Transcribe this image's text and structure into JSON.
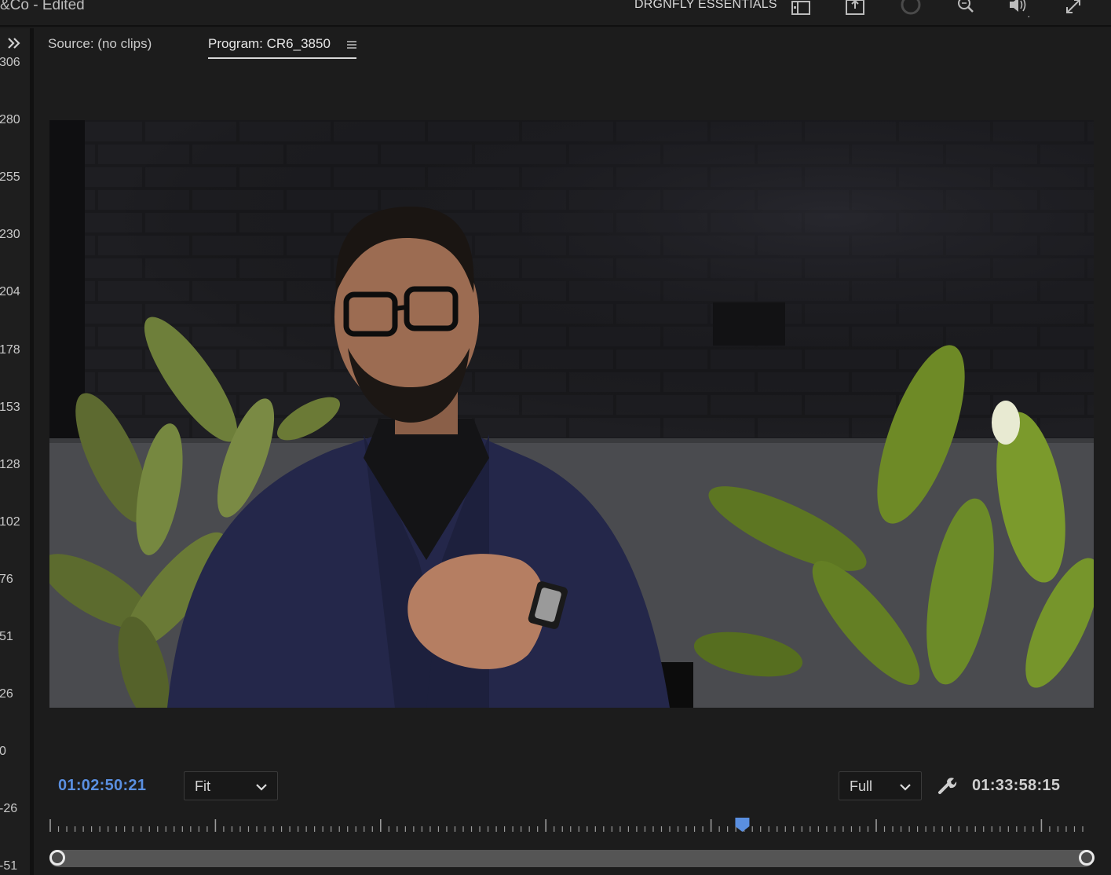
{
  "app": {
    "title": "&Co - Edited",
    "workspace": "DRGNFLY ESSENTIALS"
  },
  "toolbar_icons": [
    "panel-layout-icon",
    "export-icon",
    "progress-ring-icon",
    "search-icon",
    "volume-icon",
    "fullscreen-icon"
  ],
  "meter": {
    "expand_icon": "double-chevron-right-icon",
    "labels": [
      "306",
      "280",
      "255",
      "230",
      "204",
      "178",
      "153",
      "128",
      "102",
      "76",
      "51",
      "26",
      "0",
      "-26",
      "-51"
    ]
  },
  "tabs": {
    "source": "Source: (no clips)",
    "program": "Program: CR6_3850"
  },
  "monitor": {
    "current_timecode": "01:02:50:21",
    "duration_timecode": "01:33:58:15",
    "zoom_value": "Fit",
    "quality_value": "Full",
    "playhead_position": 0.667
  },
  "colors": {
    "accent": "#5a8fe0",
    "panel_bg": "#1c1c1c"
  }
}
